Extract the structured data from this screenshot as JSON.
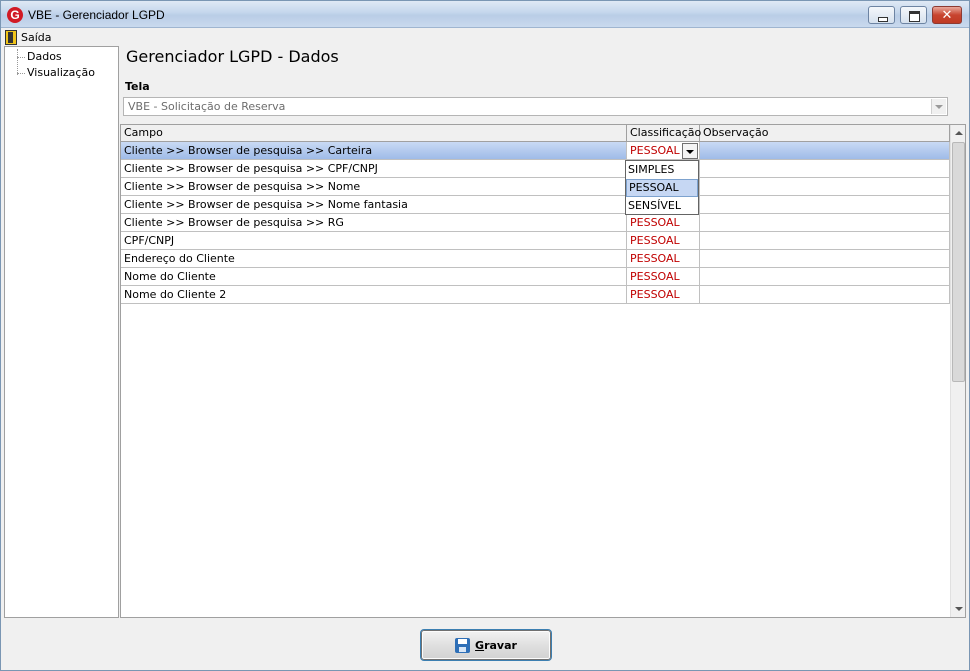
{
  "window": {
    "title": "VBE - Gerenciador LGPD",
    "app_icon_letter": "G"
  },
  "menu": {
    "exit_label": "Saída"
  },
  "tree": {
    "items": [
      "Dados",
      "Visualização"
    ]
  },
  "page": {
    "title": "Gerenciador LGPD - Dados"
  },
  "tela": {
    "label": "Tela",
    "value": "VBE - Solicitação de Reserva"
  },
  "grid": {
    "headers": {
      "campo": "Campo",
      "classificacao": "Classificação",
      "observacao": "Observação"
    },
    "rows": [
      {
        "campo": "Cliente >> Browser de pesquisa >> Carteira",
        "classificacao": "PESSOAL",
        "observacao": ""
      },
      {
        "campo": "Cliente >> Browser de pesquisa >> CPF/CNPJ",
        "classificacao": "",
        "observacao": ""
      },
      {
        "campo": "Cliente >> Browser de pesquisa >> Nome",
        "classificacao": "",
        "observacao": ""
      },
      {
        "campo": "Cliente >> Browser de pesquisa >> Nome fantasia",
        "classificacao": "",
        "observacao": ""
      },
      {
        "campo": "Cliente >> Browser de pesquisa >> RG",
        "classificacao": "PESSOAL",
        "observacao": ""
      },
      {
        "campo": "CPF/CNPJ",
        "classificacao": "PESSOAL",
        "observacao": ""
      },
      {
        "campo": "Endereço do Cliente",
        "classificacao": "PESSOAL",
        "observacao": ""
      },
      {
        "campo": "Nome do Cliente",
        "classificacao": "PESSOAL",
        "observacao": ""
      },
      {
        "campo": "Nome do Cliente 2",
        "classificacao": "PESSOAL",
        "observacao": ""
      }
    ]
  },
  "dropdown": {
    "options": [
      "SIMPLES",
      "PESSOAL",
      "SENSÍVEL"
    ],
    "selected": "PESSOAL"
  },
  "actions": {
    "save_prefix": "G",
    "save_rest": "ravar"
  },
  "colors": {
    "classification_text": "#c00000",
    "selection": "#9fbbe8"
  }
}
